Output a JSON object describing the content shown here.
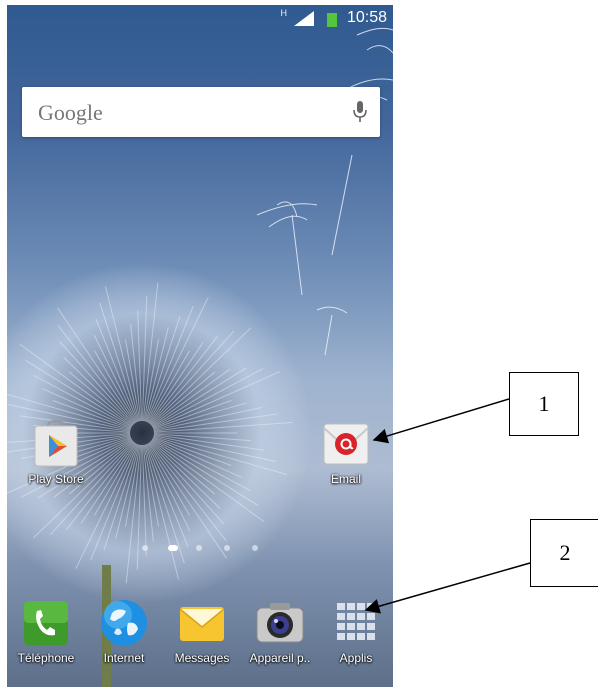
{
  "status_bar": {
    "network_type": "H",
    "time": "10:58"
  },
  "search_widget": {
    "logo_text": "Google"
  },
  "home_apps": [
    {
      "label": "Play Store"
    },
    {
      "label": "Email"
    }
  ],
  "page_indicator": {
    "pages": 5,
    "current": 2
  },
  "dock": [
    {
      "label": "Téléphone"
    },
    {
      "label": "Internet"
    },
    {
      "label": "Messages"
    },
    {
      "label": "Appareil p.."
    },
    {
      "label": "Applis"
    }
  ],
  "callouts": [
    {
      "number": "1"
    },
    {
      "number": "2"
    }
  ],
  "colors": {
    "phone_green": "#3e9a2a",
    "email_red": "#d8232a",
    "message_yellow": "#f6c530",
    "battery_green": "#55c63b"
  }
}
